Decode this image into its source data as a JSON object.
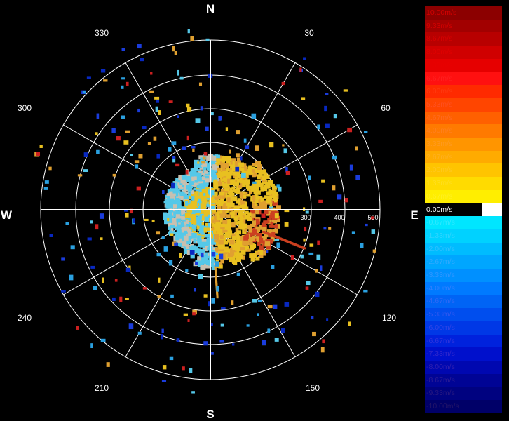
{
  "compass": {
    "n": "N",
    "e": "E",
    "s": "S",
    "w": "W"
  },
  "angles": [
    "30",
    "60",
    "120",
    "150",
    "210",
    "240",
    "300",
    "330"
  ],
  "range_labels": [
    "300",
    "400",
    "500"
  ],
  "legend": [
    {
      "label": "10.00m/s",
      "color": "#8c0000",
      "text": "#d40000"
    },
    {
      "label": "9.33m/s",
      "color": "#a20000",
      "text": "#d40000"
    },
    {
      "label": "8.67m/s",
      "color": "#b80000",
      "text": "#d80000"
    },
    {
      "label": "8.00m/s",
      "color": "#d00000",
      "text": "#e00000"
    },
    {
      "label": "7.33m/s",
      "color": "#e60000",
      "text": "#e80000"
    },
    {
      "label": "6.67m/s",
      "color": "#ff1010",
      "text": "#ff2020"
    },
    {
      "label": "6.00m/s",
      "color": "#ff2a00",
      "text": "#ff3a10"
    },
    {
      "label": "5.33m/s",
      "color": "#ff4500",
      "text": "#ff5020"
    },
    {
      "label": "4.67m/s",
      "color": "#ff6000",
      "text": "#ff6a20"
    },
    {
      "label": "4.00m/s",
      "color": "#ff7a00",
      "text": "#ff8020"
    },
    {
      "label": "3.33m/s",
      "color": "#ff9500",
      "text": "#ff9a20"
    },
    {
      "label": "2.67m/s",
      "color": "#ffab00",
      "text": "#ffb020"
    },
    {
      "label": "2.00m/s",
      "color": "#ffc400",
      "text": "#ffc820"
    },
    {
      "label": "1.33m/s",
      "color": "#ffdb00",
      "text": "#ffde20"
    },
    {
      "label": "0.67m/s",
      "color": "#ffee00",
      "text": "#fff020"
    },
    {
      "label": "0.00m/s",
      "color": "#ffffff",
      "text": "#ffffff"
    },
    {
      "label": "-0.67m/s",
      "color": "#00e6ff",
      "text": "#30e8ff"
    },
    {
      "label": "-1.33m/s",
      "color": "#00d2ff",
      "text": "#30d4ff"
    },
    {
      "label": "-2.00m/s",
      "color": "#00bcff",
      "text": "#30c0ff"
    },
    {
      "label": "-2.67m/s",
      "color": "#00a6ff",
      "text": "#30aaff"
    },
    {
      "label": "-3.33m/s",
      "color": "#0090ff",
      "text": "#3096ff"
    },
    {
      "label": "-4.00m/s",
      "color": "#007aff",
      "text": "#3080ff"
    },
    {
      "label": "-4.67m/s",
      "color": "#0064f5",
      "text": "#306af5"
    },
    {
      "label": "-5.33m/s",
      "color": "#004eee",
      "text": "#3058ee"
    },
    {
      "label": "-6.00m/s",
      "color": "#0038e6",
      "text": "#3045e6"
    },
    {
      "label": "-6.67m/s",
      "color": "#0022dd",
      "text": "#3035dd"
    },
    {
      "label": "-7.33m/s",
      "color": "#0010cc",
      "text": "#3028cc"
    },
    {
      "label": "-8.00m/s",
      "color": "#0008b0",
      "text": "#3020b0"
    },
    {
      "label": "-8.67m/s",
      "color": "#000495",
      "text": "#2a1c95"
    },
    {
      "label": "-9.33m/s",
      "color": "#000280",
      "text": "#261880"
    },
    {
      "label": "-10.00m/s",
      "color": "#000068",
      "text": "#221468"
    }
  ],
  "colors": {
    "grid": "#ffffff",
    "approach_light": "#55c8e8",
    "approach_mid": "#2aa0e0",
    "recede_yellow": "#e8c020",
    "recede_orange": "#e0a030",
    "recede_red": "#cc4020",
    "neutral_gray": "#c8c0b0"
  }
}
